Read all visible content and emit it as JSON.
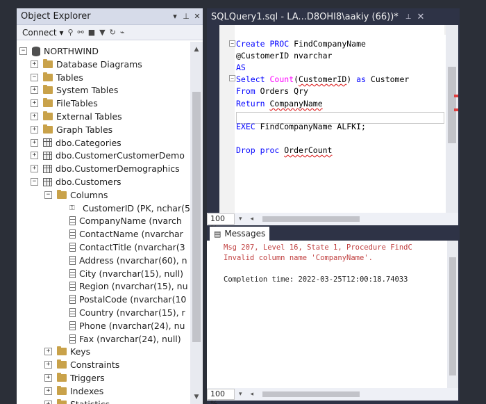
{
  "object_explorer": {
    "title": "Object Explorer",
    "controls": {
      "dropdown": "▾",
      "pin": "⊥",
      "close": "✕"
    },
    "toolbar": {
      "connect": "Connect",
      "connect_arrow": "▾",
      "refresh": "↻"
    },
    "tree": [
      {
        "label": "NORTHWIND",
        "depth": 0,
        "exp": "-",
        "icon": "database-icon"
      },
      {
        "label": "Database Diagrams",
        "depth": 1,
        "exp": "+",
        "icon": "folder-icon"
      },
      {
        "label": "Tables",
        "depth": 1,
        "exp": "-",
        "icon": "folder-icon"
      },
      {
        "label": "System Tables",
        "depth": 2,
        "exp": "+",
        "icon": "folder-icon"
      },
      {
        "label": "FileTables",
        "depth": 2,
        "exp": "+",
        "icon": "folder-icon"
      },
      {
        "label": "External Tables",
        "depth": 2,
        "exp": "+",
        "icon": "folder-icon"
      },
      {
        "label": "Graph Tables",
        "depth": 2,
        "exp": "+",
        "icon": "folder-icon"
      },
      {
        "label": "dbo.Categories",
        "depth": 2,
        "exp": "+",
        "icon": "table-icon"
      },
      {
        "label": "dbo.CustomerCustomerDemo",
        "depth": 2,
        "exp": "+",
        "icon": "table-icon"
      },
      {
        "label": "dbo.CustomerDemographics",
        "depth": 2,
        "exp": "+",
        "icon": "table-icon"
      },
      {
        "label": "dbo.Customers",
        "depth": 2,
        "exp": "-",
        "icon": "table-icon"
      },
      {
        "label": "Columns",
        "depth": 3,
        "exp": "-",
        "icon": "folder-icon"
      },
      {
        "label": "CustomerID (PK, nchar(5",
        "depth": 4,
        "exp": "",
        "icon": "key-icon"
      },
      {
        "label": "CompanyName (nvarch",
        "depth": 4,
        "exp": "",
        "icon": "column-icon"
      },
      {
        "label": "ContactName (nvarchar",
        "depth": 4,
        "exp": "",
        "icon": "column-icon"
      },
      {
        "label": "ContactTitle (nvarchar(3",
        "depth": 4,
        "exp": "",
        "icon": "column-icon"
      },
      {
        "label": "Address (nvarchar(60), n",
        "depth": 4,
        "exp": "",
        "icon": "column-icon"
      },
      {
        "label": "City (nvarchar(15), null)",
        "depth": 4,
        "exp": "",
        "icon": "column-icon"
      },
      {
        "label": "Region (nvarchar(15), nu",
        "depth": 4,
        "exp": "",
        "icon": "column-icon"
      },
      {
        "label": "PostalCode (nvarchar(10",
        "depth": 4,
        "exp": "",
        "icon": "column-icon"
      },
      {
        "label": "Country (nvarchar(15), r",
        "depth": 4,
        "exp": "",
        "icon": "column-icon"
      },
      {
        "label": "Phone (nvarchar(24), nu",
        "depth": 4,
        "exp": "",
        "icon": "column-icon"
      },
      {
        "label": "Fax (nvarchar(24), null)",
        "depth": 4,
        "exp": "",
        "icon": "column-icon"
      },
      {
        "label": "Keys",
        "depth": 3,
        "exp": "+",
        "icon": "folder-icon"
      },
      {
        "label": "Constraints",
        "depth": 3,
        "exp": "+",
        "icon": "folder-icon"
      },
      {
        "label": "Triggers",
        "depth": 3,
        "exp": "+",
        "icon": "folder-icon"
      },
      {
        "label": "Indexes",
        "depth": 3,
        "exp": "+",
        "icon": "folder-icon"
      },
      {
        "label": "Statistics",
        "depth": 3,
        "exp": "+",
        "icon": "folder-icon"
      }
    ]
  },
  "query_tab": {
    "title": "SQLQuery1.sql - LA...D8OHI8\\aakiy (66))*",
    "pin": "⊥",
    "close": "✕"
  },
  "editor": {
    "lines": {
      "l1_kw": "Create PROC",
      "l1_rest": " FindCompanyName",
      "l2": "@CustomerID nvarchar",
      "l3_kw": "AS",
      "l4_kw": "Select ",
      "l4_fn": "Count",
      "l4_open": "(",
      "l4_arg": "CustomerID",
      "l4_close": ")",
      "l4_as": " as ",
      "l4_rest": "Customer",
      "l5_kw": "From",
      "l5_rest": " Orders Qry",
      "l6_kw": "Return",
      "l6_sp": " ",
      "l6_rest": "CompanyName",
      "l7_kw": "EXEC",
      "l7_rest": " FindCompanyName ALFKI;",
      "l8_kw": "Drop proc",
      "l8_sp": " ",
      "l8_rest": "OrderCount"
    }
  },
  "zoom": {
    "editor": "100 %",
    "messages": "100 %"
  },
  "messages": {
    "tab_label": "Messages",
    "error_line1": "Msg 207, Level 16, State 1, Procedure FindC",
    "error_line2": "Invalid column name 'CompanyName'.",
    "completion": "Completion time: 2022-03-25T12:00:18.74033"
  },
  "colors": {
    "keyword": "#0000ff",
    "function": "#ff00ff",
    "error": "#c04040"
  }
}
